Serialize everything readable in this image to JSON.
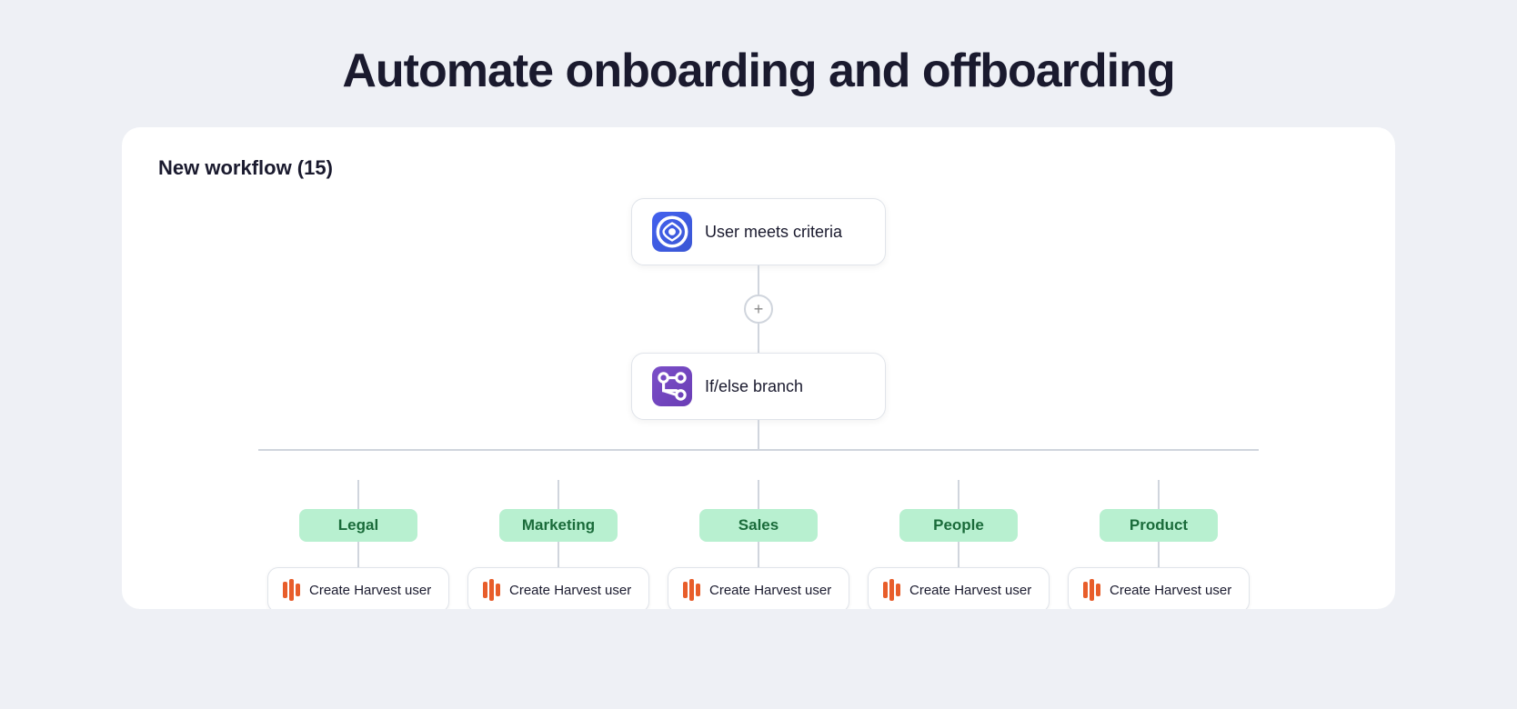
{
  "page": {
    "title": "Automate onboarding and offboarding"
  },
  "workflow": {
    "title": "New workflow (15)",
    "nodes": {
      "criteria": {
        "label": "User meets criteria",
        "icon_type": "blue"
      },
      "branch": {
        "label": "If/else branch",
        "icon_type": "purple"
      }
    },
    "branches": [
      {
        "label": "Legal",
        "action": "Create Harvest user"
      },
      {
        "label": "Marketing",
        "action": "Create Harvest user"
      },
      {
        "label": "Sales",
        "action": "Create Harvest user"
      },
      {
        "label": "People",
        "action": "Create Harvest user"
      },
      {
        "label": "Product",
        "action": "Create Harvest user"
      }
    ],
    "add_button": "+"
  }
}
